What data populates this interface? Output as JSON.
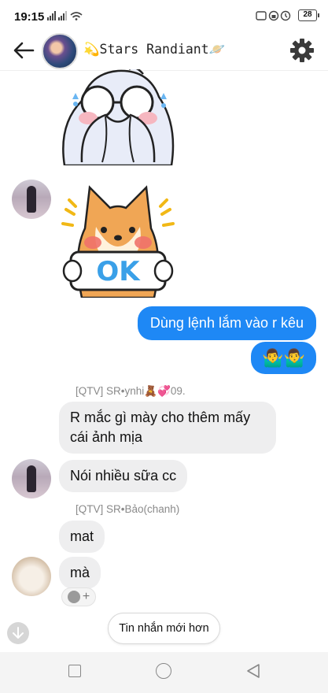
{
  "status_bar": {
    "time": "19:15",
    "battery": "28"
  },
  "header": {
    "title": "💫Stars Randiant🪐"
  },
  "messages": [
    {
      "type": "outgoing",
      "text": "Dùng lệnh lắm vào r kêu"
    },
    {
      "type": "outgoing",
      "text": "🤷‍♂️🤷‍♂️"
    },
    {
      "type": "sender",
      "text": "[QTV] SR•ynhi🧸💞09."
    },
    {
      "type": "incoming",
      "text": "R mắc gì mày cho thêm mấy cái ảnh mịa"
    },
    {
      "type": "incoming",
      "text": "Nói nhiều sữa cc"
    },
    {
      "type": "sender",
      "text": "[QTV] SR•Bảo(chanh)"
    },
    {
      "type": "incoming",
      "text": "mat"
    },
    {
      "type": "incoming",
      "text": "mà"
    }
  ],
  "stickers": [
    "bunny-covering-face-sticker",
    "shiba-ok-sticker"
  ],
  "new_messages_button": "Tin nhắn mới hơn",
  "reaction": "+",
  "colors": {
    "accent": "#1e88f5",
    "incoming_bubble": "#eeeeef"
  }
}
